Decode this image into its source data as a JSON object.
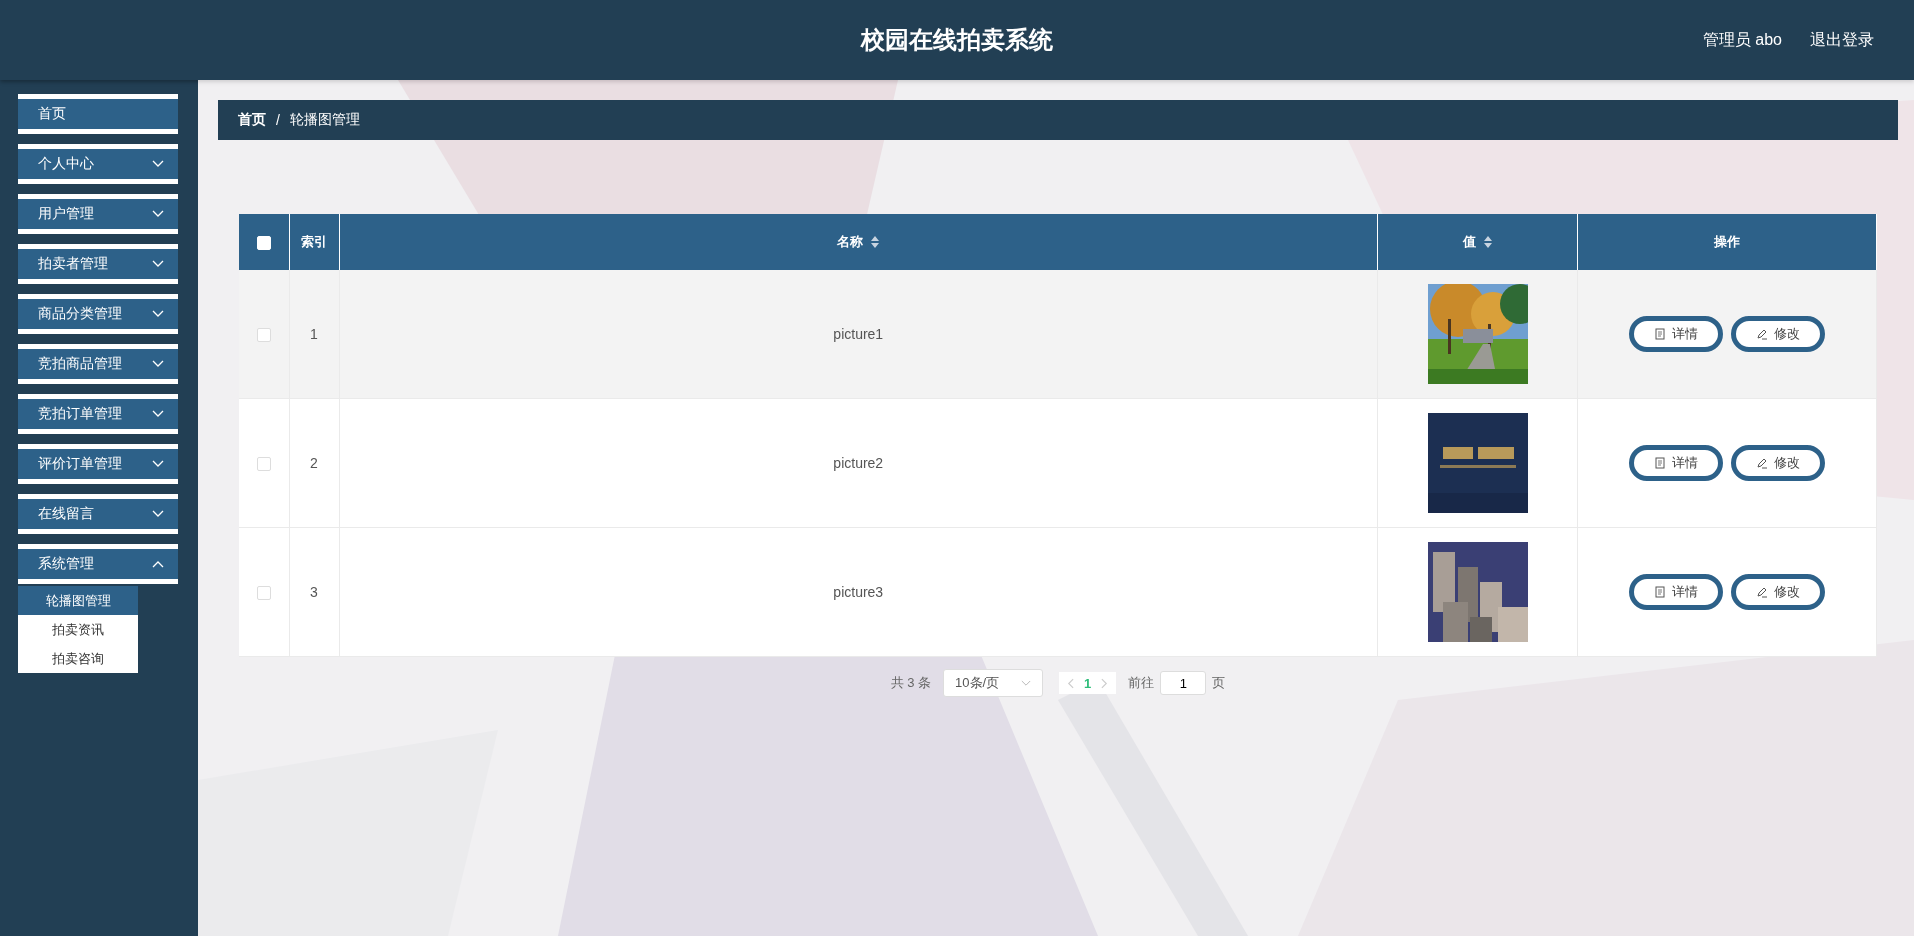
{
  "header": {
    "title": "校园在线拍卖系统",
    "user": "管理员 abo",
    "logout": "退出登录"
  },
  "sidebar": {
    "items": [
      {
        "label": "首页",
        "kind": "link"
      },
      {
        "label": "个人中心",
        "kind": "submenu",
        "expanded": false
      },
      {
        "label": "用户管理",
        "kind": "submenu",
        "expanded": false
      },
      {
        "label": "拍卖者管理",
        "kind": "submenu",
        "expanded": false
      },
      {
        "label": "商品分类管理",
        "kind": "submenu",
        "expanded": false
      },
      {
        "label": "竞拍商品管理",
        "kind": "submenu",
        "expanded": false
      },
      {
        "label": "竞拍订单管理",
        "kind": "submenu",
        "expanded": false
      },
      {
        "label": "评价订单管理",
        "kind": "submenu",
        "expanded": false
      },
      {
        "label": "在线留言",
        "kind": "submenu",
        "expanded": false
      },
      {
        "label": "系统管理",
        "kind": "submenu",
        "expanded": true,
        "children": [
          {
            "label": "轮播图管理",
            "selected": true
          },
          {
            "label": "拍卖资讯",
            "selected": false
          },
          {
            "label": "拍卖咨询",
            "selected": false
          }
        ]
      }
    ]
  },
  "breadcrumb": {
    "items": [
      "首页",
      "轮播图管理"
    ],
    "separator": "/"
  },
  "table": {
    "columns": [
      {
        "kind": "checkbox",
        "checked": false
      },
      {
        "kind": "text",
        "label": "索引",
        "sortable": false
      },
      {
        "kind": "text",
        "label": "名称",
        "sortable": true
      },
      {
        "kind": "text",
        "label": "值",
        "sortable": true
      },
      {
        "kind": "text",
        "label": "操作",
        "sortable": false
      }
    ],
    "rows": [
      {
        "checked": false,
        "hovered": true,
        "index": "1",
        "name": "picture1",
        "value": {
          "kind": "picture"
        },
        "actions": [
          {
            "kind": "details",
            "label": "详情"
          },
          {
            "kind": "edit",
            "label": "修改"
          }
        ]
      },
      {
        "checked": false,
        "hovered": false,
        "index": "2",
        "name": "picture2",
        "value": {
          "kind": "picture"
        },
        "actions": [
          {
            "kind": "details",
            "label": "详情"
          },
          {
            "kind": "edit",
            "label": "修改"
          }
        ]
      },
      {
        "checked": false,
        "hovered": false,
        "index": "3",
        "name": "picture3",
        "value": {
          "kind": "picture"
        },
        "actions": [
          {
            "kind": "details",
            "label": "详情"
          },
          {
            "kind": "edit",
            "label": "修改"
          }
        ]
      }
    ]
  },
  "pagination": {
    "total": "共 3 条",
    "page_size": "10条/页",
    "pages": [
      {
        "label": "1",
        "selected": true
      }
    ],
    "goto_label": "前往",
    "goto_value": "1",
    "goto_suffix": "页"
  }
}
